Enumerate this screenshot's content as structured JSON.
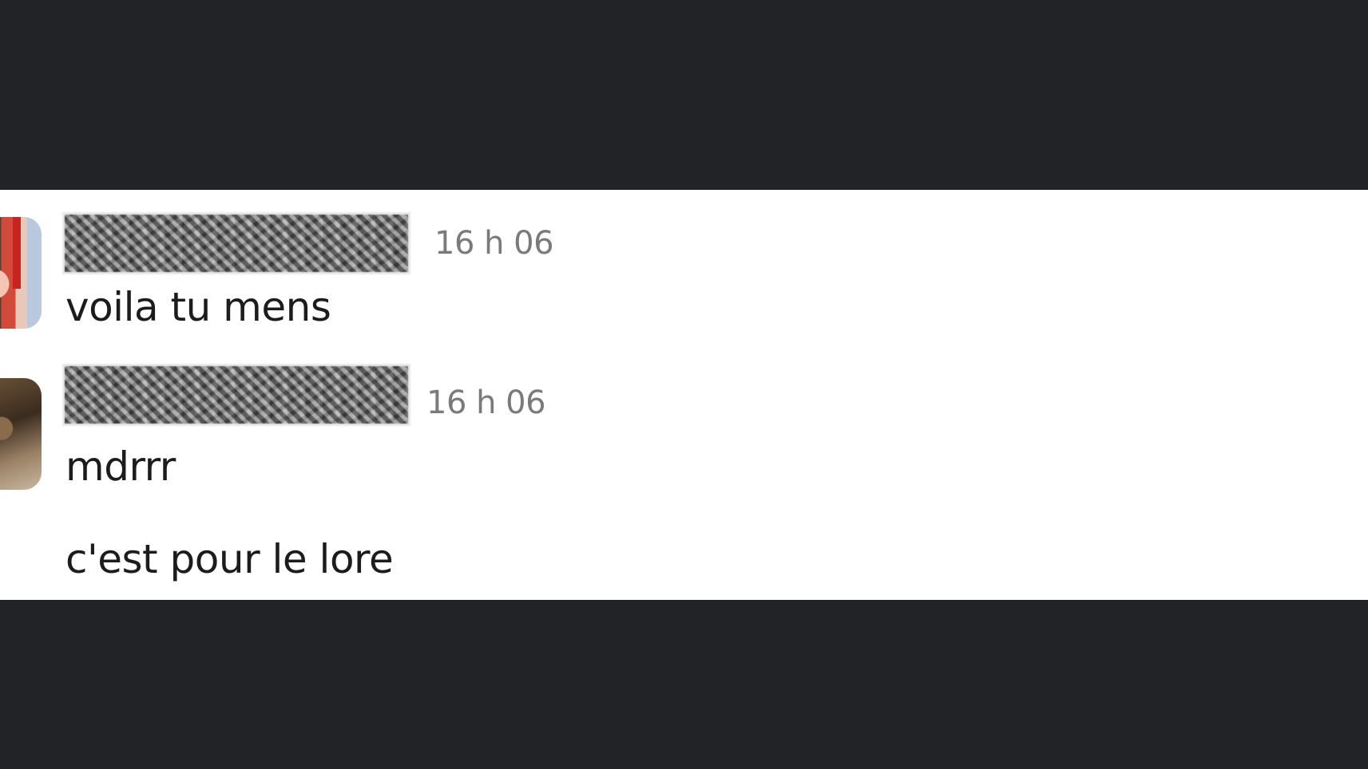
{
  "messages": [
    {
      "sender": "",
      "timestamp": "16 h 06",
      "lines": [
        "voila tu mens"
      ]
    },
    {
      "sender": "",
      "timestamp": "16 h 06",
      "lines": [
        "mdrrr",
        "c'est pour le lore"
      ]
    }
  ],
  "colors": {
    "frame_background": "#222326",
    "panel_background": "#ffffff",
    "message_text": "#1d1c1d",
    "timestamp_text": "#7a7a7a"
  },
  "icons": {
    "avatar_1": "avatar-photo",
    "avatar_2": "avatar-photo-cat"
  }
}
